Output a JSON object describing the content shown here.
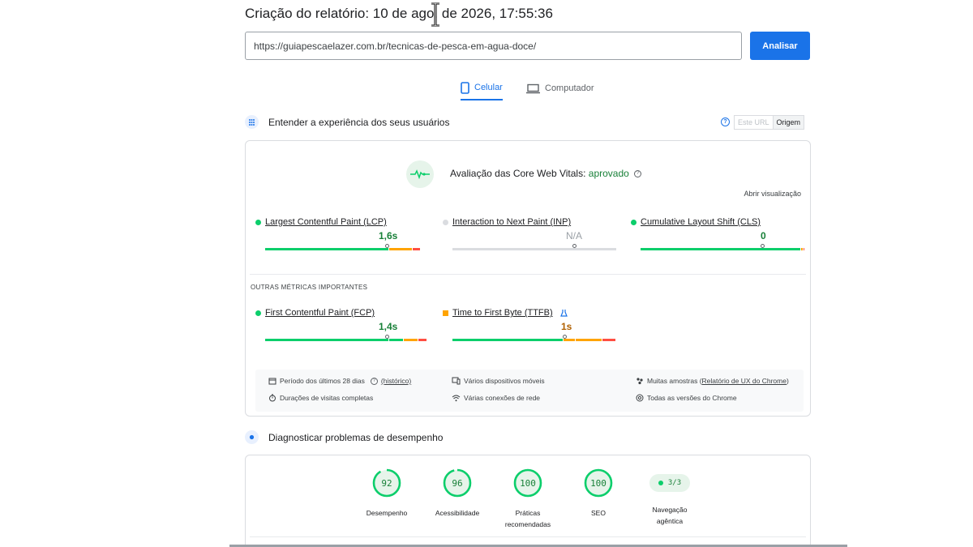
{
  "report": {
    "title": "Criação do relatório: 10 de ago. de 2026, 17:55:36"
  },
  "search": {
    "url": "https://guiapescaelazer.com.br/tecnicas-de-pesca-em-agua-doce/",
    "analyze_label": "Analisar"
  },
  "tabs": [
    {
      "label": "Celular",
      "active": true
    },
    {
      "label": "Computador",
      "active": false
    }
  ],
  "field_data": {
    "title": "Entender a experiência dos seus usuários",
    "toggle": [
      {
        "label": "Este URL",
        "active": false
      },
      {
        "label": "Origem",
        "active": true
      }
    ],
    "assessment": {
      "prefix": "Avaliação das Core Web Vitals:",
      "status": "aprovado"
    },
    "open_view": "Abrir visualização",
    "core_metrics": [
      {
        "name": "Largest Contentful Paint (LCP)",
        "value": "1,6s",
        "status": "good",
        "position": 0.75
      },
      {
        "name": "Interaction to Next Paint (INP)",
        "value": "N/A",
        "status": "none",
        "position": 0.75
      },
      {
        "name": "Cumulative Layout Shift (CLS)",
        "value": "0",
        "status": "good",
        "position": 0.75
      }
    ],
    "other_title": "OUTRAS MÉTRICAS IMPORTANTES",
    "other_metrics": [
      {
        "name": "First Contentful Paint (FCP)",
        "value": "1,4s",
        "status": "good",
        "position": 0.75
      },
      {
        "name": "Time to First Byte (TTFB)",
        "value": "1s",
        "status": "average",
        "position": 0.75
      }
    ],
    "info": {
      "period": "Período dos últimos 28 dias",
      "history_link": "(histórico)",
      "devices": "Vários dispositivos móveis",
      "samples_prefix": "Muitas amostras (",
      "samples_link": "Relatório de UX do Chrome",
      "samples_suffix": ")",
      "durations": "Durações de visitas completas",
      "connections": "Várias conexões de rede",
      "versions": "Todas as versões do Chrome"
    }
  },
  "lab": {
    "title": "Diagnosticar problemas de desempenho",
    "scores": [
      {
        "value": "92",
        "label": "Desempenho",
        "fraction": 0.92
      },
      {
        "value": "96",
        "label": "Acessibilidade",
        "fraction": 0.96
      },
      {
        "value": "100",
        "label": "Práticas recomendadas",
        "fraction": 1.0
      },
      {
        "value": "100",
        "label": "SEO",
        "fraction": 1.0
      }
    ],
    "agentic": {
      "value": "3/3",
      "label": "Navegação agêntica"
    }
  },
  "colors": {
    "good": "#0cce6b",
    "average": "#ffa400",
    "poor": "#ff4e42",
    "accent": "#1a73e8",
    "pass_text": "#188038"
  }
}
